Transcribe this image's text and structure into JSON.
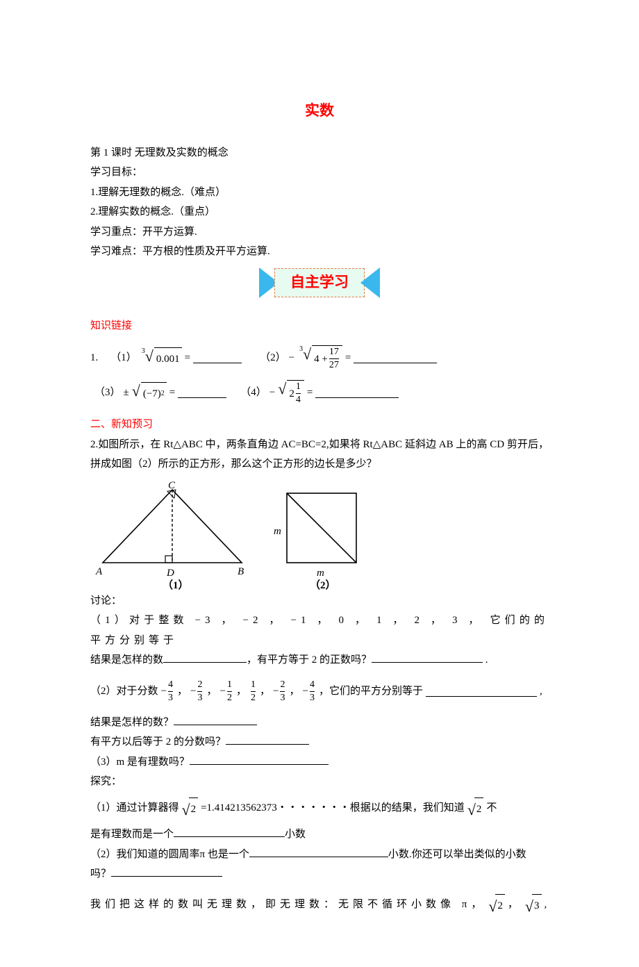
{
  "title": "实数",
  "lessonHeader": "第 1 课时  无理数及实数的概念",
  "goalsLabel": "学习目标：",
  "goal1": "1.理解无理数的概念.（难点）",
  "goal2": "2.理解实数的概念.（重点）",
  "keyLabel": "学习重点：开平方运算.",
  "diffLabel": "学习难点：平方根的性质及开平方运算.",
  "bannerText": "自主学习",
  "sectionLink": "知识链接",
  "section2": "二、新知预习",
  "q1_prefix": "1.",
  "q1_1_label": "（1）",
  "q1_1_expr_idx": "3",
  "q1_1_expr_rad": "0.001",
  "eq": "=",
  "q1_2_label": "（2）",
  "minus": "−",
  "q1_2_idx": "3",
  "q1_2_inner1": "4 +",
  "q1_2_frac_num": "17",
  "q1_2_frac_den": "27",
  "q1_3_label": "（3）",
  "pm": "±",
  "q1_3_rad": "(−7)",
  "q1_3_sup": "2",
  "q1_4_label": "（4）",
  "q1_4_inner1": "2",
  "q1_4_frac_num": "1",
  "q1_4_frac_den": "4",
  "q2_text": "2.如图所示，在 Rt△ABC 中，两条直角边 AC=BC=2,如果将 Rt△ABC 延斜边 AB 上的高 CD 剪开后，拼成如图（2）所示的正方形，那么这个正方形的边长是多少？",
  "figA": "A",
  "figB": "B",
  "figC": "C",
  "figD": "D",
  "figM": "m",
  "figNum1": "（1）",
  "figNum2": "（2）",
  "discuss": "讨论：",
  "d1_line1": "（1）对于整数 −3 ， −2 ， −1 ， 0 ， 1 ， 2 ， 3 ， 它们的的平方分别等于",
  "d1_line2a": "结果是怎样的数",
  "d1_line2b": "，有平方等于 2 的正数吗？",
  "d1_line2c": " .",
  "d2_pre": "（2）对于分数",
  "d2_tail": "，它们的平方分别等于",
  "d2_end": ",",
  "f1n": "4",
  "f1d": "3",
  "f2n": "2",
  "f2d": "3",
  "f3n": "1",
  "f3d": "2",
  "f4n": "1",
  "f4d": "2",
  "f5n": "2",
  "f5d": "3",
  "f6n": "4",
  "f6d": "3",
  "comma": "，",
  "d2_q1": "结果是怎样的数？",
  "d2_q2": "有平方以后等于 2 的分数吗？",
  "d3": "（3）m 是有理数吗？",
  "explore": "探究：",
  "e1_pre": "（1）通过计算器得",
  "e1_val": "=1.414213562373・・・・・・・根据以的结果，我们知道",
  "e1_tail": "不",
  "e1_line2a": "是有理数而是一个",
  "e1_line2b": "小数",
  "e2_pre": "（2）我们知道的圆周率π 也是一个",
  "e2_tail": "小数.你还可以举出类似的小数",
  "e2_q": "吗？",
  "summary_pre": " 我们把这样的数叫无理数，即无理数：无限不循环小数像 π，",
  "summary_comma": " ，",
  "sqrt2": "2",
  "sqrt3": "3",
  "dot_comma": ","
}
